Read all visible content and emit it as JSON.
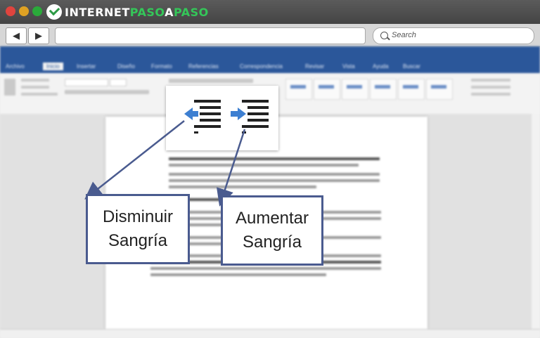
{
  "browser": {
    "logo": {
      "part1": "INTERNET",
      "part2": "PASO",
      "part3": "A",
      "part4": "PASO"
    },
    "back_icon": "left-arrow-icon",
    "forward_icon": "right-arrow-icon",
    "url": "",
    "search_placeholder": "Search"
  },
  "word": {
    "tabs": [
      "Archivo",
      "Inicio",
      "Insertar",
      "Diseño",
      "Formato",
      "Referencias",
      "Correspondencia",
      "Revisar",
      "Vista",
      "Ayuda",
      "Buscar"
    ],
    "active_tab": 1,
    "accent_color": "#2b579a"
  },
  "callout": {
    "decrease_icon": "decrease-indent-icon",
    "increase_icon": "increase-indent-icon",
    "decrease_label_line1": "Disminuir",
    "decrease_label_line2": "Sangría",
    "increase_label_line1": "Aumentar",
    "increase_label_line2": "Sangría",
    "arrow_color": "#4a5b8f",
    "icon_arrow_color": "#3d7fd1"
  }
}
